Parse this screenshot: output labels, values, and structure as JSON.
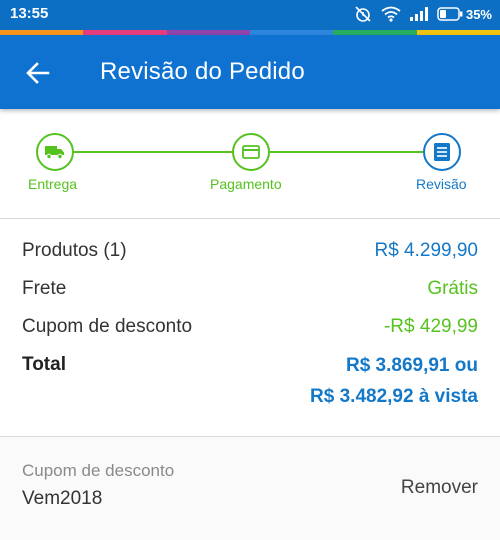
{
  "status_bar": {
    "time": "13:55",
    "battery_percent": "35%",
    "icons": [
      "alarm-off-icon",
      "wifi-icon",
      "signal-icon",
      "battery-icon"
    ]
  },
  "header": {
    "title": "Revisão do Pedido",
    "back_icon": "arrow-left-icon"
  },
  "stepper": {
    "steps": [
      {
        "label": "Entrega",
        "icon": "truck-icon",
        "state": "complete"
      },
      {
        "label": "Pagamento",
        "icon": "credit-card-icon",
        "state": "complete"
      },
      {
        "label": "Revisão",
        "icon": "list-icon",
        "state": "active"
      }
    ]
  },
  "summary": {
    "products_label": "Produtos (1)",
    "products_value": "R$ 4.299,90",
    "shipping_label": "Frete",
    "shipping_value": "Grátis",
    "coupon_label": "Cupom de desconto",
    "coupon_value": "-R$ 429,99",
    "total_label": "Total",
    "total_value": "R$ 3.869,91 ou",
    "total_cash_value": "R$ 3.482,92 à vista"
  },
  "coupon": {
    "label": "Cupom de desconto",
    "code": "Vem2018",
    "remove_label": "Remover"
  },
  "colors": {
    "primary": "#0f72d1",
    "accent_blue": "#1478c8",
    "success_green": "#56c21f"
  }
}
